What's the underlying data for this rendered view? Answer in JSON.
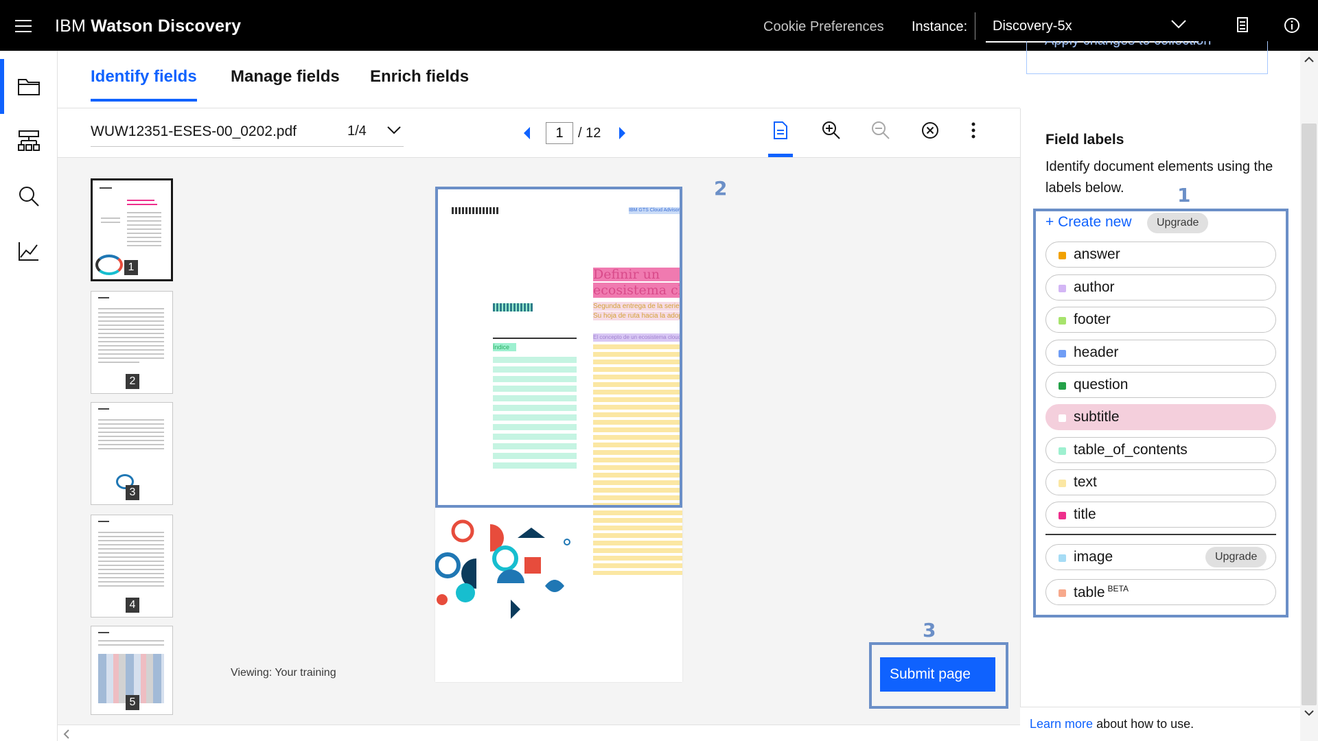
{
  "topbar": {
    "brand_prefix": "IBM",
    "brand_name": "Watson Discovery",
    "cookie": "Cookie Preferences",
    "instance_label": "Instance:",
    "instance_value": "Discovery-5x",
    "icons": [
      "menu-icon",
      "chevron-down-icon",
      "notebook-icon",
      "info-icon"
    ]
  },
  "leftnav": {
    "items": [
      {
        "name": "projects-folder-icon",
        "active": true
      },
      {
        "name": "data-model-icon",
        "active": false
      },
      {
        "name": "search-icon",
        "active": false
      },
      {
        "name": "analytics-chart-icon",
        "active": false
      }
    ]
  },
  "tabs": [
    {
      "label": "Identify fields",
      "active": true
    },
    {
      "label": "Manage fields",
      "active": false
    },
    {
      "label": "Enrich fields",
      "active": false
    }
  ],
  "apply_button": "Apply changes to collection",
  "toolbar": {
    "file_name": "WUW12351-ESES-00_0202.pdf",
    "file_count": "1/4",
    "page_current": "1",
    "page_total": "/ 12",
    "tools": [
      "document-view-icon",
      "zoom-in-icon",
      "zoom-out-icon",
      "clear-icon",
      "overflow-menu-icon"
    ]
  },
  "thumbnails": [
    {
      "num": "1",
      "selected": true
    },
    {
      "num": "2",
      "selected": false
    },
    {
      "num": "3",
      "selected": false
    },
    {
      "num": "4",
      "selected": false
    },
    {
      "num": "5",
      "selected": false
    }
  ],
  "viewing": "Viewing: Your training",
  "document_page": {
    "title_line1": "Definir un",
    "title_line2": "ecosistema cloud",
    "subtitle_line1": "Segunda entrega de la serie:",
    "subtitle_line2": "Su hoja de ruta hacia la adopción del cloud",
    "header_right": "IBM GTS Cloud Advisory Services",
    "toc_title": "Índice",
    "section_heading": "El concepto de un ecosistema cloud"
  },
  "callouts": [
    "1",
    "2",
    "3"
  ],
  "submit_label": "Submit page",
  "right_panel": {
    "title": "Field labels",
    "description": "Identify document elements using the labels below.",
    "create_new": "+ Create new",
    "upgrade": "Upgrade",
    "labels": [
      {
        "text": "answer",
        "color": "#f1a100",
        "selected": false
      },
      {
        "text": "author",
        "color": "#d3b6f5",
        "selected": false
      },
      {
        "text": "footer",
        "color": "#a7e36c",
        "selected": false
      },
      {
        "text": "header",
        "color": "#6f9df5",
        "selected": false
      },
      {
        "text": "question",
        "color": "#24a148",
        "selected": false
      },
      {
        "text": "subtitle",
        "color": "#f4cfdc",
        "selected": true
      },
      {
        "text": "table_of_contents",
        "color": "#9ef0d0",
        "selected": false
      },
      {
        "text": "text",
        "color": "#fbe7a3",
        "selected": false
      },
      {
        "text": "title",
        "color": "#ee2f8c",
        "selected": false
      }
    ],
    "extra_labels": [
      {
        "text": "image",
        "color": "#a6dcf5",
        "tag": "Upgrade"
      },
      {
        "text": "table",
        "color": "#f7a98c",
        "tag": "BETA"
      }
    ],
    "footer_link": "Learn more",
    "footer_text": " about how to use."
  }
}
